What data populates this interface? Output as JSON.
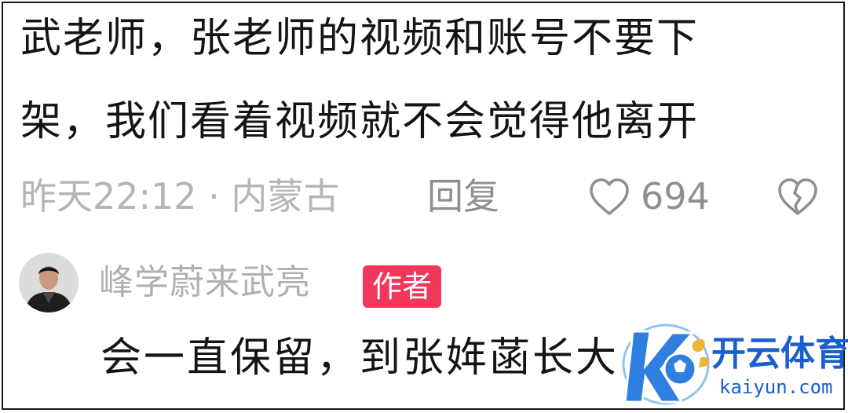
{
  "comment": {
    "line1": "武老师，张老师的视频和账号不要下",
    "line2": "架，我们看着视频就不会觉得他离开",
    "time_location": "昨天22:12 · 内蒙古",
    "reply_label": "回复",
    "like_icon": "heart-outline-icon",
    "like_count": "694",
    "dislike_icon": "broken-heart-icon"
  },
  "reply": {
    "author": "峰学蔚来武亮",
    "badge": "作者",
    "text": "会一直保留，到张姩菡长大"
  },
  "watermark": {
    "brand": "开云体育",
    "url": "kaiyun.com"
  },
  "colors": {
    "text": "#141414",
    "muted": "#b5b5b5",
    "badge": "#f2375a",
    "watermark": "#1a5fcf"
  }
}
